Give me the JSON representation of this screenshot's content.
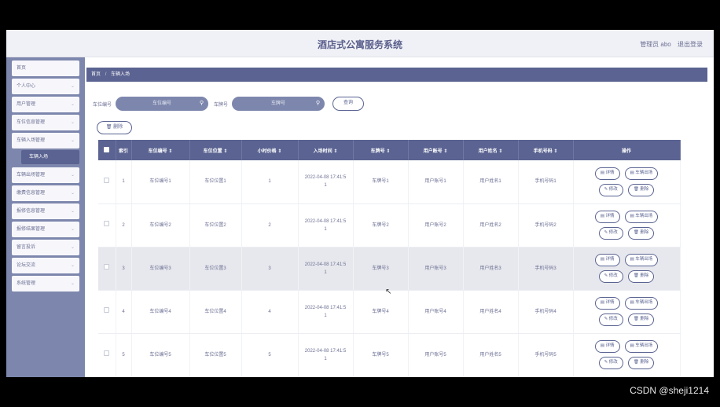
{
  "header": {
    "title": "酒店式公寓服务系统",
    "admin_label": "管理员 abo",
    "logout": "退出登录"
  },
  "sidebar": {
    "items": [
      {
        "label": "首页",
        "chev": ""
      },
      {
        "label": "个人中心",
        "chev": "⌄"
      },
      {
        "label": "用户管理",
        "chev": "⌄"
      },
      {
        "label": "车位信息管理",
        "chev": "⌄"
      },
      {
        "label": "车辆入场管理",
        "chev": "⌄"
      },
      {
        "label": "车辆出场管理",
        "chev": "⌄"
      },
      {
        "label": "缴费信息管理",
        "chev": "⌄"
      },
      {
        "label": "报修信息管理",
        "chev": "⌄"
      },
      {
        "label": "报修结果管理",
        "chev": "⌄"
      },
      {
        "label": "留言投诉",
        "chev": "⌄"
      },
      {
        "label": "论坛交流",
        "chev": "⌄"
      },
      {
        "label": "系统管理",
        "chev": "⌄"
      }
    ],
    "active_sub": "车辆入场"
  },
  "breadcrumb": {
    "home": "首页",
    "separator": "/",
    "current": "车辆入场"
  },
  "search": {
    "label1": "车位编号",
    "placeholder1": "车位编号",
    "label2": "车牌号",
    "placeholder2": "车牌号",
    "search_icon": "search-icon",
    "query_button": "查询"
  },
  "toolbar": {
    "delete_button": "删除"
  },
  "table": {
    "headers": [
      "索引",
      "车位编号 ⇕",
      "车位位置 ⇕",
      "小时价格 ⇕",
      "入场时间 ⇕",
      "车牌号 ⇕",
      "用户账号 ⇕",
      "用户姓名 ⇕",
      "手机号码 ⇕",
      "操作"
    ],
    "rows": [
      {
        "index": "1",
        "slot_no": "车位编号1",
        "slot_pos": "车位位置1",
        "price": "1",
        "time": "2022-04-08 17:41:5",
        "time2": "1",
        "plate": "车牌号1",
        "account": "用户账号1",
        "name": "用户姓名1",
        "phone": "手机号码1"
      },
      {
        "index": "2",
        "slot_no": "车位编号2",
        "slot_pos": "车位位置2",
        "price": "2",
        "time": "2022-04-08 17:41:5",
        "time2": "1",
        "plate": "车牌号2",
        "account": "用户账号2",
        "name": "用户姓名2",
        "phone": "手机号码2"
      },
      {
        "index": "3",
        "slot_no": "车位编号3",
        "slot_pos": "车位位置3",
        "price": "3",
        "time": "2022-04-08 17:41:5",
        "time2": "1",
        "plate": "车牌号3",
        "account": "用户账号3",
        "name": "用户姓名3",
        "phone": "手机号码3"
      },
      {
        "index": "4",
        "slot_no": "车位编号4",
        "slot_pos": "车位位置4",
        "price": "4",
        "time": "2022-04-08 17:41:5",
        "time2": "1",
        "plate": "车牌号4",
        "account": "用户账号4",
        "name": "用户姓名4",
        "phone": "手机号码4"
      },
      {
        "index": "5",
        "slot_no": "车位编号5",
        "slot_pos": "车位位置5",
        "price": "5",
        "time": "2022-04-08 17:41:5",
        "time2": "1",
        "plate": "车牌号5",
        "account": "用户账号5",
        "name": "用户姓名5",
        "phone": "手机号码5"
      }
    ],
    "ops": {
      "detail": "详情",
      "exit": "车辆出场",
      "edit": "修改",
      "delete": "删除"
    },
    "highlight_row": 3
  },
  "watermark": "CSDN @sheji1214"
}
